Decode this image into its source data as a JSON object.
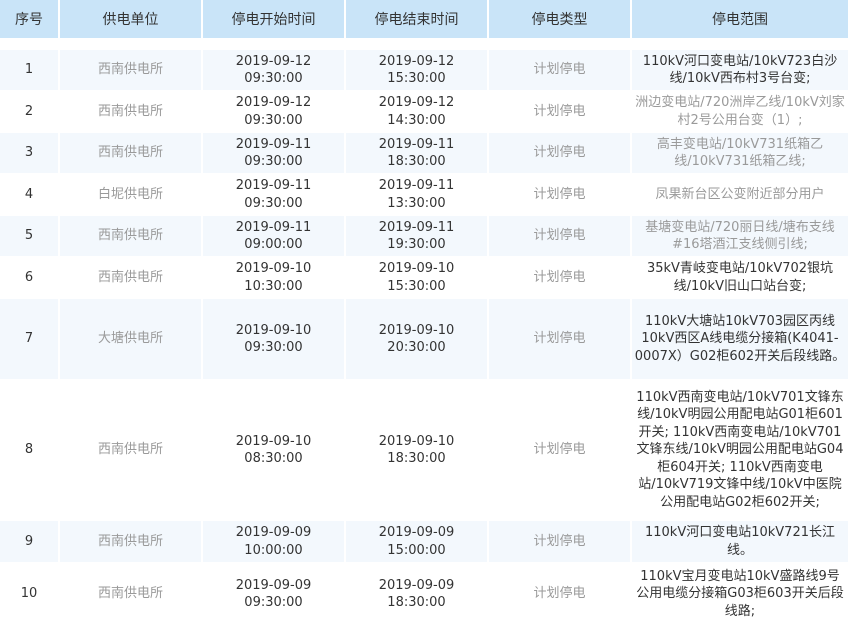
{
  "headers": [
    "序号",
    "供电单位",
    "停电开始时间",
    "停电结束时间",
    "停电类型",
    "停电范围"
  ],
  "rows": [
    {
      "no": "1",
      "unit": "西南供电所",
      "start": "2019-09-12 09:30:00",
      "end": "2019-09-12 15:30:00",
      "type": "计划停电",
      "scope": "110kV河口变电站/10kV723白沙线/10kV西布村3号台变;"
    },
    {
      "no": "2",
      "unit": "西南供电所",
      "start": "2019-09-12 09:30:00",
      "end": "2019-09-12 14:30:00",
      "type": "计划停电",
      "scope": "洲边变电站/720洲岸乙线/10kV刘家村2号公用台变（1）;"
    },
    {
      "no": "3",
      "unit": "西南供电所",
      "start": "2019-09-11 09:30:00",
      "end": "2019-09-11 18:30:00",
      "type": "计划停电",
      "scope": "高丰变电站/10kV731纸箱乙线/10kV731纸箱乙线;"
    },
    {
      "no": "4",
      "unit": "白坭供电所",
      "start": "2019-09-11 09:30:00",
      "end": "2019-09-11 13:30:00",
      "type": "计划停电",
      "scope": "凤果新台区公变附近部分用户"
    },
    {
      "no": "5",
      "unit": "西南供电所",
      "start": "2019-09-11 09:00:00",
      "end": "2019-09-11 19:30:00",
      "type": "计划停电",
      "scope": "基塘变电站/720丽日线/塘布支线#16塔酒江支线侧引线;"
    },
    {
      "no": "6",
      "unit": "西南供电所",
      "start": "2019-09-10 10:30:00",
      "end": "2019-09-10 15:30:00",
      "type": "计划停电",
      "scope": "35kV青岐变电站/10kV702银坑线/10kV旧山口站台变;"
    },
    {
      "no": "7",
      "unit": "大塘供电所",
      "start": "2019-09-10 09:30:00",
      "end": "2019-09-10 20:30:00",
      "type": "计划停电",
      "scope": "110kV大塘站10kV703园区丙线10kV西区A线电缆分接箱(K4041-0007X）G02柜602开关后段线路。"
    },
    {
      "no": "8",
      "unit": "西南供电所",
      "start": "2019-09-10 08:30:00",
      "end": "2019-09-10 18:30:00",
      "type": "计划停电",
      "scope": "110kV西南变电站/10kV701文锋东线/10kV明园公用配电站G01柜601开关; 110kV西南变电站/10kV701文锋东线/10kV明园公用配电站G04柜604开关; 110kV西南变电站/10kV719文锋中线/10kV中医院公用配电站G02柜602开关;"
    },
    {
      "no": "9",
      "unit": "西南供电所",
      "start": "2019-09-09 10:00:00",
      "end": "2019-09-09 15:00:00",
      "type": "计划停电",
      "scope": "110kV河口变电站10kV721长江线。"
    },
    {
      "no": "10",
      "unit": "西南供电所",
      "start": "2019-09-09 09:30:00",
      "end": "2019-09-09 18:30:00",
      "type": "计划停电",
      "scope": "110kV宝月变电站10kV盛路线9号公用电缆分接箱G03柜603开关后段线路;"
    }
  ]
}
